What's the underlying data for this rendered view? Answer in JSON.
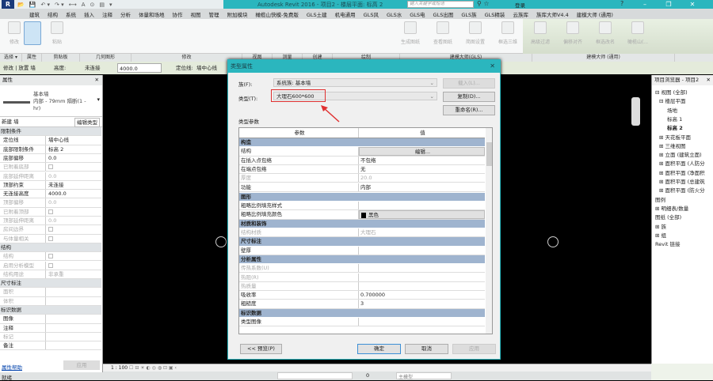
{
  "app": {
    "title": "Autodesk Revit 2016 -   项目2 - 楼层平面: 标高 2",
    "search_placeholder": "键入关键字或短语",
    "login": "登录"
  },
  "menu": [
    "建筑",
    "结构",
    "系统",
    "插入",
    "注释",
    "分析",
    "体量和场地",
    "协作",
    "视图",
    "管理",
    "附加模块",
    "橄榄山快模-免费版",
    "GLS土建",
    "机电通用",
    "GLS风",
    "GLS水",
    "GLS电",
    "GLS出图",
    "GLS族",
    "GLS精装",
    "云族库",
    "族库大师V4.4",
    "建模大师 (通用)"
  ],
  "ribbon": {
    "modify": "修改",
    "paste": "粘贴",
    "gls": [
      "生成图纸",
      "查看图纸",
      "简图设置",
      "框选三维",
      "高级过滤",
      "偏移对齐",
      "框选改名",
      "橄榄山(..."
    ],
    "panels": [
      "选择 ▾",
      "属性",
      "剪贴板",
      "几何图形",
      "修改",
      "视图",
      "测量",
      "创建",
      "绘制",
      "建模大师(GLS)",
      "建模大师 (通用)"
    ]
  },
  "options": {
    "context": "修改 | 放置 墙",
    "height_label": "高度:",
    "height_value": "未连接",
    "height_num": "4000.0",
    "loc_label": "定位线:",
    "loc_value": "墙中心线"
  },
  "properties": {
    "title": "属性",
    "type_family": "基本墙",
    "type_name": "内部 - 79mm 隔断(1 - hr)",
    "instance": "新建 墙",
    "edit_type": "编辑类型",
    "help": "属性帮助",
    "apply": "应用",
    "rows": [
      {
        "k": "限制条件",
        "sec": true
      },
      {
        "k": "定位线",
        "v": "墙中心线"
      },
      {
        "k": "底部限制条件",
        "v": "标高 2"
      },
      {
        "k": "底部偏移",
        "v": "0.0"
      },
      {
        "k": "已附着底部",
        "cb": true,
        "dis": true
      },
      {
        "k": "底部延伸距离",
        "v": "0.0",
        "dis": true
      },
      {
        "k": "顶部约束",
        "v": "未连接"
      },
      {
        "k": "无连接高度",
        "v": "4000.0"
      },
      {
        "k": "顶部偏移",
        "v": "0.0",
        "dis": true
      },
      {
        "k": "已附着顶部",
        "cb": true,
        "dis": true
      },
      {
        "k": "顶部延伸距离",
        "v": "0.0",
        "dis": true
      },
      {
        "k": "房间边界",
        "cb": true,
        "dis": true
      },
      {
        "k": "与体量相关",
        "cb": true,
        "dis": true
      },
      {
        "k": "结构",
        "sec": true
      },
      {
        "k": "结构",
        "cb": true,
        "dis": true
      },
      {
        "k": "启用分析模型",
        "cb": true,
        "dis": true
      },
      {
        "k": "结构用途",
        "v": "非承重",
        "dis": true
      },
      {
        "k": "尺寸标注",
        "sec": true
      },
      {
        "k": "面积",
        "dis": true
      },
      {
        "k": "体积",
        "dis": true
      },
      {
        "k": "标识数据",
        "sec": true
      },
      {
        "k": "图像"
      },
      {
        "k": "注释"
      },
      {
        "k": "标记",
        "dis": true
      },
      {
        "k": "备注"
      }
    ]
  },
  "browser": {
    "title": "项目浏览器 - 项目2",
    "items": [
      {
        "t": "⊟ 视图 (全部)",
        "l": 0
      },
      {
        "t": "⊟ 楼层平面",
        "l": 1
      },
      {
        "t": "场地",
        "l": 3
      },
      {
        "t": "标高 1",
        "l": 3
      },
      {
        "t": "标高 2",
        "l": 3,
        "b": true
      },
      {
        "t": "⊞ 天花板平面",
        "l": 1
      },
      {
        "t": "⊞ 三维视图",
        "l": 1
      },
      {
        "t": "⊞ 立面 (建筑立面)",
        "l": 1
      },
      {
        "t": "⊞ 面积平面 (人防分",
        "l": 1
      },
      {
        "t": "⊞ 面积平面 (净面积",
        "l": 1
      },
      {
        "t": "⊞ 面积平面 (总建筑",
        "l": 1
      },
      {
        "t": "⊞ 面积平面 (防火分",
        "l": 1
      },
      {
        "t": "图例",
        "l": 0
      },
      {
        "t": "⊞ 明细表/数量",
        "l": 0
      },
      {
        "t": "图纸 (全部)",
        "l": 0
      },
      {
        "t": "⊞ 族",
        "l": 0
      },
      {
        "t": "⊞ 组",
        "l": 0
      },
      {
        "t": "Revit 链接",
        "l": 0
      }
    ]
  },
  "status": {
    "ready": "就绪",
    "scale": "1 : 100",
    "coord": "0",
    "model": "主模型"
  },
  "dialog": {
    "title": "类型属性",
    "family_label": "族(F):",
    "family_value": "系统族: 基本墙",
    "type_label": "类型(T):",
    "type_value": "大理石600*600",
    "load": "载入(L)...",
    "duplicate": "复制(D)...",
    "rename": "重命名(R)...",
    "params_label": "类型参数",
    "col_param": "参数",
    "col_value": "值",
    "preview": "<< 预览(P)",
    "ok": "确定",
    "cancel": "取消",
    "apply": "应用",
    "highlight_color": "#e03030",
    "rows": [
      {
        "k": "构造",
        "sec": true
      },
      {
        "k": "结构",
        "v": "编辑...",
        "btn": true
      },
      {
        "k": "在插入点包络",
        "v": "不包络"
      },
      {
        "k": "在端点包络",
        "v": "无"
      },
      {
        "k": "厚度",
        "v": "20.0",
        "dis": true
      },
      {
        "k": "功能",
        "v": "内部"
      },
      {
        "k": "图形",
        "sec": true
      },
      {
        "k": "粗略比例填充样式"
      },
      {
        "k": "粗略比例填充颜色",
        "v": "黑色",
        "btn": true,
        "swatch": true
      },
      {
        "k": "材质和装饰",
        "sec": true
      },
      {
        "k": "结构材质",
        "v": "大理石",
        "dis": true
      },
      {
        "k": "尺寸标注",
        "sec": true
      },
      {
        "k": "壁厚"
      },
      {
        "k": "分析属性",
        "sec": true
      },
      {
        "k": "传热系数(U)",
        "dis": true
      },
      {
        "k": "热阻(R)",
        "dis": true
      },
      {
        "k": "热质量",
        "dis": true
      },
      {
        "k": "吸收率",
        "v": "0.700000"
      },
      {
        "k": "粗糙度",
        "v": "3"
      },
      {
        "k": "标识数据",
        "sec": true
      },
      {
        "k": "类型图像"
      }
    ]
  }
}
